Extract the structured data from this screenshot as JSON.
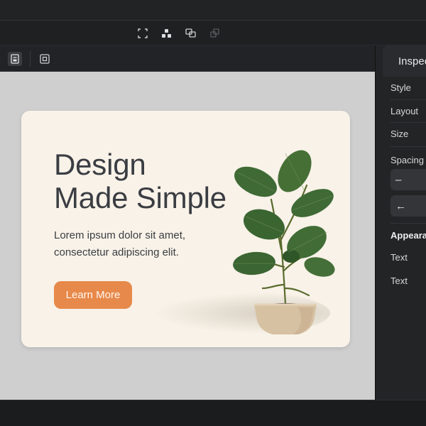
{
  "toolbar": {
    "tools": [
      {
        "icon": "frame-select-icon"
      },
      {
        "icon": "components-icon"
      },
      {
        "icon": "duplicate-icon"
      },
      {
        "icon": "overlap-icon"
      }
    ]
  },
  "canvas_toolbar": {
    "buttons": [
      {
        "icon": "page-view-icon",
        "active": true
      },
      {
        "icon": "frame-view-icon",
        "active": false
      }
    ]
  },
  "card": {
    "headline_line1": "Design",
    "headline_line2": "Made Simple",
    "body_line1": "Lorem ipsum dolor sit amet,",
    "body_line2": "consectetur adipiscing elit.",
    "cta_label": "Learn More",
    "background": "#f8f2e8",
    "accent": "#e7894a",
    "text_color": "#3a3d42"
  },
  "inspector": {
    "title": "Inspector",
    "rows": [
      "Style",
      "Layout",
      "Size",
      "Spacing"
    ],
    "spacing_controls": [
      "–",
      "←"
    ],
    "appearance_label": "Appearance",
    "appearance_rows": [
      "Text",
      "Text"
    ]
  },
  "colors": {
    "canvas_bg": "#cfcfcf",
    "panel_bg": "#232426",
    "chrome_bg": "#1f2022"
  }
}
